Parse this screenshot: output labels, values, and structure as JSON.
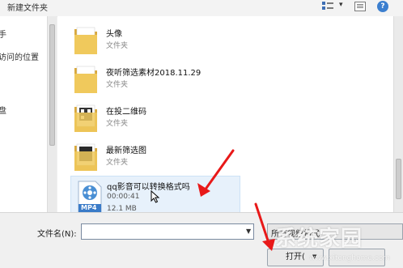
{
  "toolbar": {
    "new_folder_label": "新建文件夹",
    "view_icon": "view-icon",
    "panel_icon": "preview-pane-icon",
    "help_icon": "help-icon",
    "help_glyph": "?"
  },
  "nav": {
    "items": [
      {
        "label": "手"
      },
      {
        "label": "访问的位置"
      },
      {
        "label": "盘"
      }
    ]
  },
  "files": [
    {
      "name": "头像",
      "type": "文件夹",
      "icon": "folder-icon"
    },
    {
      "name": "夜听筛选素材2018.11.29",
      "type": "文件夹",
      "icon": "folder-icon"
    },
    {
      "name": "在投二维码",
      "type": "文件夹",
      "icon": "folder-icon"
    },
    {
      "name": "最新筛选图",
      "type": "文件夹",
      "icon": "folder-icon"
    }
  ],
  "selected_file": {
    "name": "qq影音可以转换格式吗",
    "duration": "00:00:41",
    "size": "12.1 MB",
    "badge": "MP4",
    "icon": "mp4-file-icon"
  },
  "bottom": {
    "filename_label": "文件名(N):",
    "filename_value": "",
    "filetype_value": "所有视频格式",
    "open_label": "打开(",
    "cancel_label": ""
  },
  "watermark": {
    "text": "系统家园",
    "url": "www.xitonghome.com"
  },
  "colors": {
    "selection": "#e7f1fb",
    "annotation_arrow": "#e81919",
    "folder": "#e8c15a"
  }
}
